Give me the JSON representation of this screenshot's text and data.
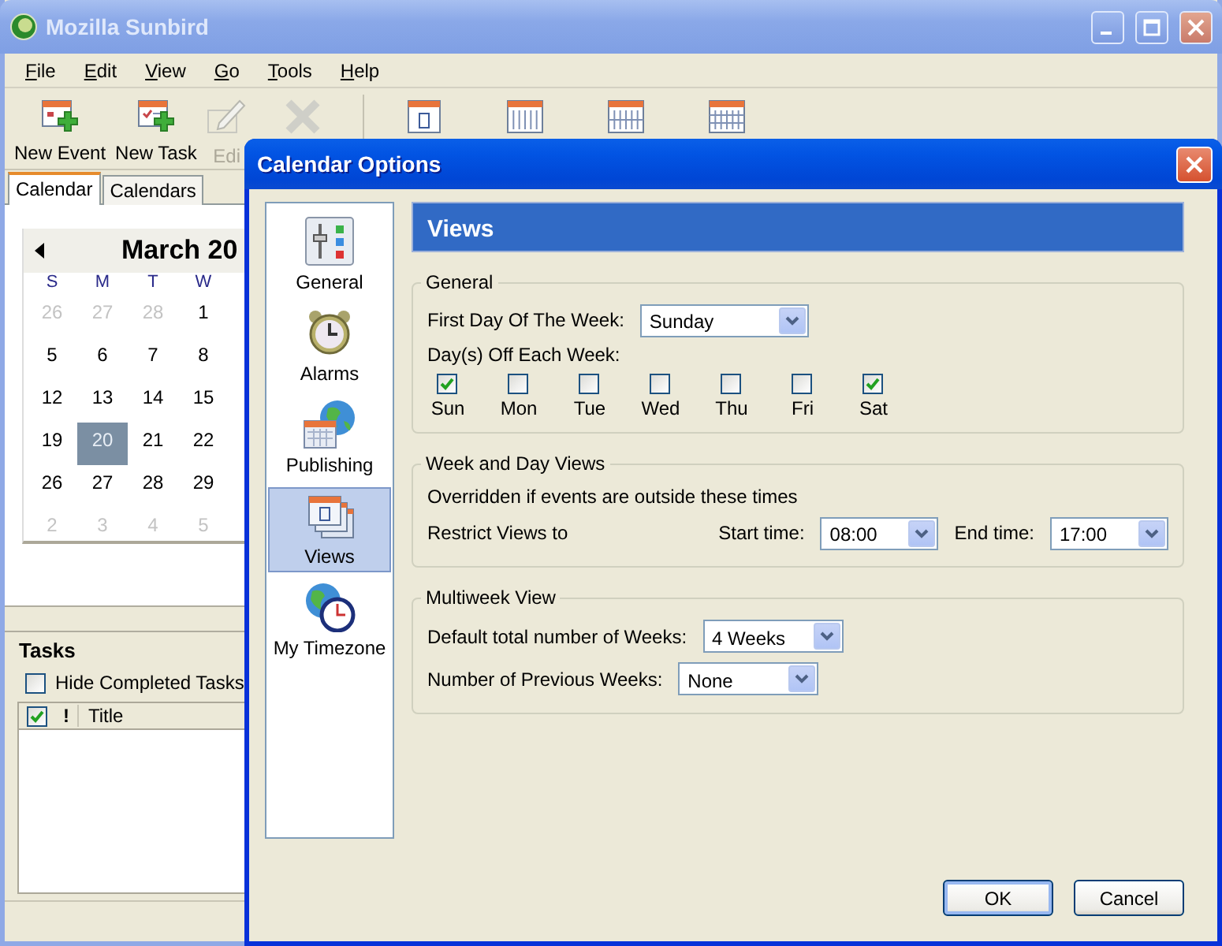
{
  "window": {
    "title": "Mozilla Sunbird"
  },
  "menu": [
    {
      "label": "File"
    },
    {
      "label": "Edit"
    },
    {
      "label": "View"
    },
    {
      "label": "Go"
    },
    {
      "label": "Tools"
    },
    {
      "label": "Help"
    }
  ],
  "toolbar": [
    {
      "kind": "new-event",
      "label": "New Event",
      "disabled": false
    },
    {
      "kind": "new-task",
      "label": "New Task",
      "disabled": false
    },
    {
      "kind": "edit",
      "label": "Edi",
      "disabled": true
    },
    {
      "kind": "delete",
      "disabled": true
    },
    {
      "kind": "separator"
    },
    {
      "kind": "day"
    },
    {
      "kind": "week"
    },
    {
      "kind": "multiweek"
    },
    {
      "kind": "month"
    }
  ],
  "tabs": [
    {
      "label": "Calendar",
      "selected": true
    },
    {
      "label": "Calendars",
      "selected": false
    }
  ],
  "minicalendar": {
    "month": "March 20",
    "weekdays": [
      "S",
      "M",
      "T",
      "W"
    ],
    "weeks": [
      [
        {
          "day": "26",
          "other_month": true,
          "selected": false
        },
        {
          "day": "27",
          "other_month": true,
          "selected": false
        },
        {
          "day": "28",
          "other_month": true,
          "selected": false
        },
        {
          "day": "1",
          "other_month": false,
          "selected": false
        }
      ],
      [
        {
          "day": "5",
          "other_month": false,
          "selected": false
        },
        {
          "day": "6",
          "other_month": false,
          "selected": false
        },
        {
          "day": "7",
          "other_month": false,
          "selected": false
        },
        {
          "day": "8",
          "other_month": false,
          "selected": false
        }
      ],
      [
        {
          "day": "12",
          "other_month": false,
          "selected": false
        },
        {
          "day": "13",
          "other_month": false,
          "selected": false
        },
        {
          "day": "14",
          "other_month": false,
          "selected": false
        },
        {
          "day": "15",
          "other_month": false,
          "selected": false
        }
      ],
      [
        {
          "day": "19",
          "other_month": false,
          "selected": false
        },
        {
          "day": "20",
          "other_month": false,
          "selected": true
        },
        {
          "day": "21",
          "other_month": false,
          "selected": false
        },
        {
          "day": "22",
          "other_month": false,
          "selected": false
        }
      ],
      [
        {
          "day": "26",
          "other_month": false,
          "selected": false
        },
        {
          "day": "27",
          "other_month": false,
          "selected": false
        },
        {
          "day": "28",
          "other_month": false,
          "selected": false
        },
        {
          "day": "29",
          "other_month": false,
          "selected": false
        }
      ],
      [
        {
          "day": "2",
          "other_month": true,
          "selected": false
        },
        {
          "day": "3",
          "other_month": true,
          "selected": false
        },
        {
          "day": "4",
          "other_month": true,
          "selected": false
        },
        {
          "day": "5",
          "other_month": true,
          "selected": false
        }
      ]
    ]
  },
  "tasks": {
    "title": "Tasks",
    "hide_completed": {
      "label": "Hide Completed Tasks",
      "checked": false
    },
    "columns": [
      {
        "kind": "completed",
        "checked": true
      },
      {
        "kind": "text",
        "label": "!"
      },
      {
        "kind": "text",
        "label": "Title"
      }
    ]
  },
  "dialog": {
    "title": "Calendar Options",
    "categories": [
      {
        "kind": "general",
        "label": "General",
        "selected": false
      },
      {
        "kind": "alarms",
        "label": "Alarms",
        "selected": false
      },
      {
        "kind": "publishing",
        "label": "Publishing",
        "selected": false
      },
      {
        "kind": "views",
        "label": "Views",
        "selected": true
      },
      {
        "kind": "timezone",
        "label": "My Timezone",
        "selected": false
      }
    ],
    "heading": "Views",
    "general": {
      "title": "General",
      "first_day": {
        "label": "First Day Of The Week:",
        "value": "Sunday"
      },
      "days_off": {
        "label": "Day(s) Off Each Week:",
        "days": [
          {
            "label": "Sun",
            "checked": true
          },
          {
            "label": "Mon",
            "checked": false
          },
          {
            "label": "Tue",
            "checked": false
          },
          {
            "label": "Wed",
            "checked": false
          },
          {
            "label": "Thu",
            "checked": false
          },
          {
            "label": "Fri",
            "checked": false
          },
          {
            "label": "Sat",
            "checked": true
          }
        ]
      }
    },
    "week_day_views": {
      "title": "Week and Day Views",
      "note": "Overridden if events are outside these times",
      "restrict_label": "Restrict Views to",
      "start": {
        "label": "Start time:",
        "value": "08:00"
      },
      "end": {
        "label": "End time:",
        "value": "17:00"
      }
    },
    "multiweek_view": {
      "title": "Multiweek View",
      "total_weeks": {
        "label": "Default total number of Weeks:",
        "value": "4 Weeks"
      },
      "previous_weeks": {
        "label": "Number of Previous Weeks:",
        "value": "None"
      }
    },
    "buttons": [
      {
        "label": "OK",
        "default": true
      },
      {
        "label": "Cancel",
        "default": false
      }
    ]
  }
}
